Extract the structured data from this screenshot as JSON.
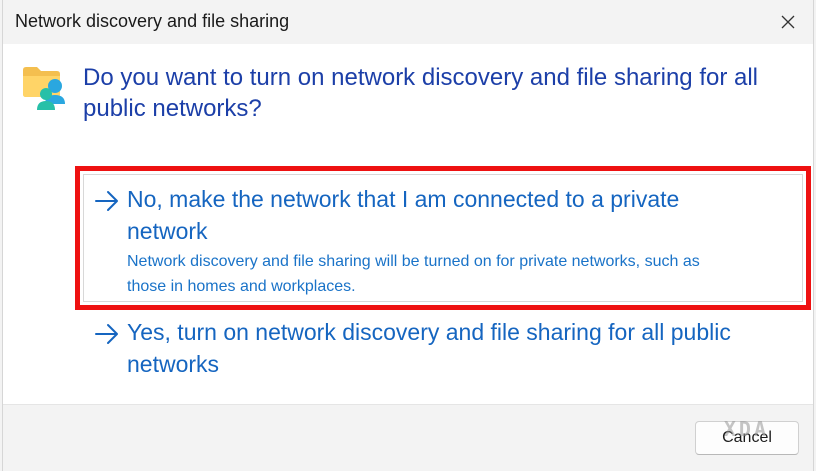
{
  "window": {
    "title": "Network discovery and file sharing",
    "close_icon": "close-icon"
  },
  "dialog": {
    "icon": "network-folder-icon",
    "question": "Do you want to turn on network discovery and file sharing for all public networks?"
  },
  "options": [
    {
      "icon": "arrow-right-icon",
      "title_line1": "No, make the network that I am connected to a private",
      "title_line2": "network",
      "desc_line1": "Network discovery and file sharing will be turned on for private networks, such as",
      "desc_line2": "those in homes and workplaces.",
      "highlighted": true
    },
    {
      "icon": "arrow-right-icon",
      "title_line1": "Yes, turn on network discovery and file sharing for all public",
      "title_line2": "networks"
    }
  ],
  "footer": {
    "cancel_label": "Cancel",
    "watermark": "XDA"
  },
  "colors": {
    "accent_text": "#1565c0",
    "question_text": "#1c3fa8",
    "highlight_border": "#ee1111"
  }
}
